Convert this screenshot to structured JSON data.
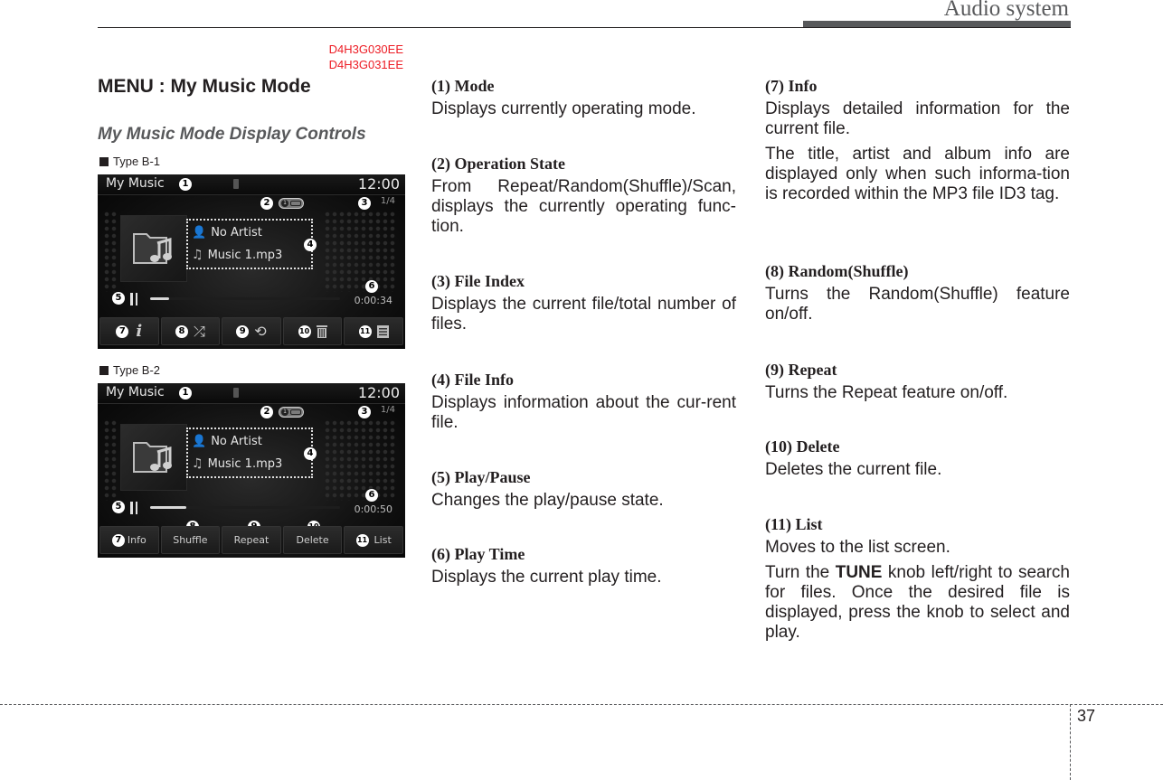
{
  "header": {
    "section_title": "Audio system"
  },
  "doc_codes": [
    "D4H3G030EE",
    "D4H3G031EE"
  ],
  "title": "MENU : My Music Mode",
  "subtitle": "My Music Mode Display Controls",
  "screens": [
    {
      "type_label": "Type B-1",
      "mode": "My Music",
      "clock": "12:00",
      "file_index": "1/4",
      "op_state_badge": "1",
      "artist": "No Artist",
      "song": "Music 1.mp3",
      "play_time": "0:00:34",
      "progress_fraction": 0.1,
      "buttons": [
        {
          "id": "info",
          "callout": "7",
          "icon": "info-icon",
          "glyph": "i"
        },
        {
          "id": "shuffle",
          "callout": "8",
          "icon": "shuffle-icon",
          "glyph": "⤮"
        },
        {
          "id": "repeat",
          "callout": "9",
          "icon": "repeat-icon",
          "glyph": "⟲"
        },
        {
          "id": "delete",
          "callout": "10",
          "icon": "trash-icon",
          "glyph": "🗑"
        },
        {
          "id": "list",
          "callout": "11",
          "icon": "list-icon",
          "glyph": "☰"
        }
      ]
    },
    {
      "type_label": "Type B-2",
      "mode": "My Music",
      "clock": "12:00",
      "file_index": "1/4",
      "op_state_badge": "1",
      "artist": "No Artist",
      "song": "Music 1.mp3",
      "play_time": "0:00:50",
      "progress_fraction": 0.19,
      "buttons": [
        {
          "id": "info",
          "callout": "7",
          "label": "Info"
        },
        {
          "id": "shuffle",
          "callout": "8",
          "label": "Shuffle"
        },
        {
          "id": "repeat",
          "callout": "9",
          "label": "Repeat"
        },
        {
          "id": "delete",
          "callout": "10",
          "label": "Delete"
        },
        {
          "id": "list",
          "callout": "11",
          "label": "List"
        }
      ]
    }
  ],
  "callouts": [
    "1",
    "2",
    "3",
    "4",
    "5",
    "6",
    "7",
    "8",
    "9",
    "10",
    "11"
  ],
  "descriptions": [
    {
      "heading": "(1) Mode",
      "paragraphs": [
        "Displays currently operating mode."
      ]
    },
    {
      "heading": "(2) Operation State",
      "paragraphs": [
        "From Repeat/Random(Shuffle)/Scan, displays the currently operating func-tion."
      ]
    },
    {
      "heading": "(3) File Index",
      "paragraphs": [
        "Displays the current file/total number of files."
      ]
    },
    {
      "heading": "(4) File Info",
      "paragraphs": [
        "Displays information about the cur-rent file."
      ]
    },
    {
      "heading": "(5) Play/Pause",
      "paragraphs": [
        "Changes the play/pause state."
      ]
    },
    {
      "heading": "(6) Play Time",
      "paragraphs": [
        "Displays the current play time."
      ]
    },
    {
      "heading": "(7) Info",
      "paragraphs": [
        "Displays detailed information for the current file.",
        "The title, artist and album info are displayed only when such informa-tion is recorded within the MP3 file ID3 tag."
      ]
    },
    {
      "heading": "(8) Random(Shuffle)",
      "paragraphs": [
        "Turns the Random(Shuffle) feature on/off."
      ]
    },
    {
      "heading": "(9) Repeat",
      "paragraphs": [
        "Turns the Repeat feature on/off."
      ]
    },
    {
      "heading": "(10) Delete",
      "paragraphs": [
        "Deletes the current file."
      ]
    },
    {
      "heading": "(11) List",
      "paragraphs": [
        "Moves to the list screen."
      ],
      "extra": {
        "before": "Turn the ",
        "bold": "TUNE",
        "after": " knob left/right to search for files. Once the desired file is displayed, press the knob to select and play."
      }
    }
  ],
  "footer": {
    "page_number": "37"
  }
}
